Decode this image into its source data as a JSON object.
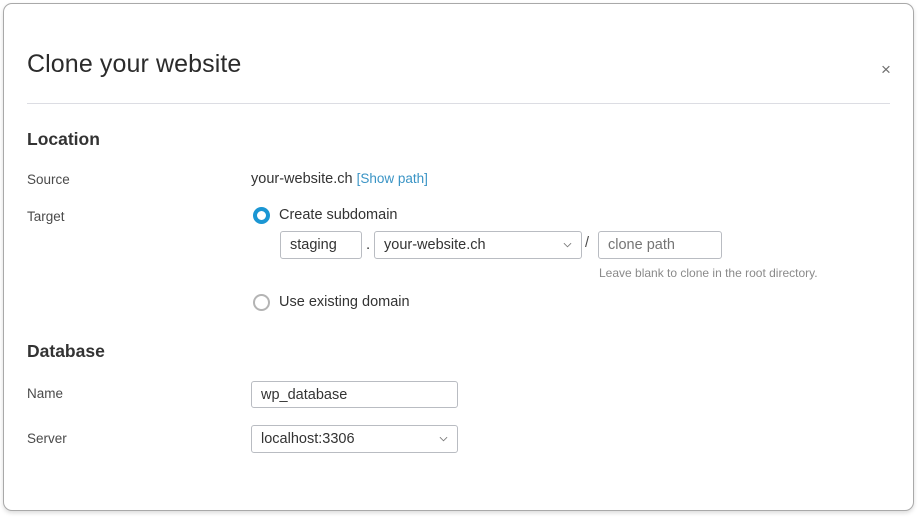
{
  "dialog": {
    "title": "Clone your website",
    "close_icon": "close-icon",
    "close_label": "×"
  },
  "location": {
    "heading": "Location",
    "source": {
      "label": "Source",
      "value": "your-website.ch",
      "link_text": "[Show path]"
    },
    "target": {
      "label": "Target",
      "options": [
        {
          "label": "Create subdomain",
          "selected": true
        },
        {
          "label": "Use existing domain",
          "selected": false
        }
      ],
      "subdomain_value": "staging",
      "dot_separator": ".",
      "domain_selected": "your-website.ch",
      "slash_separator": "/",
      "clone_path_value": "",
      "clone_path_placeholder": "clone path",
      "helper_text": "Leave blank to clone in the root directory."
    }
  },
  "database": {
    "heading": "Database",
    "name": {
      "label": "Name",
      "value": "wp_database"
    },
    "server": {
      "label": "Server",
      "value": "localhost:3306"
    }
  },
  "colors": {
    "accent": "#1b96d3",
    "link": "#3a94c5",
    "border": "#b9bcc2",
    "divider": "#dcdde3",
    "helper": "#8a8a8a"
  }
}
